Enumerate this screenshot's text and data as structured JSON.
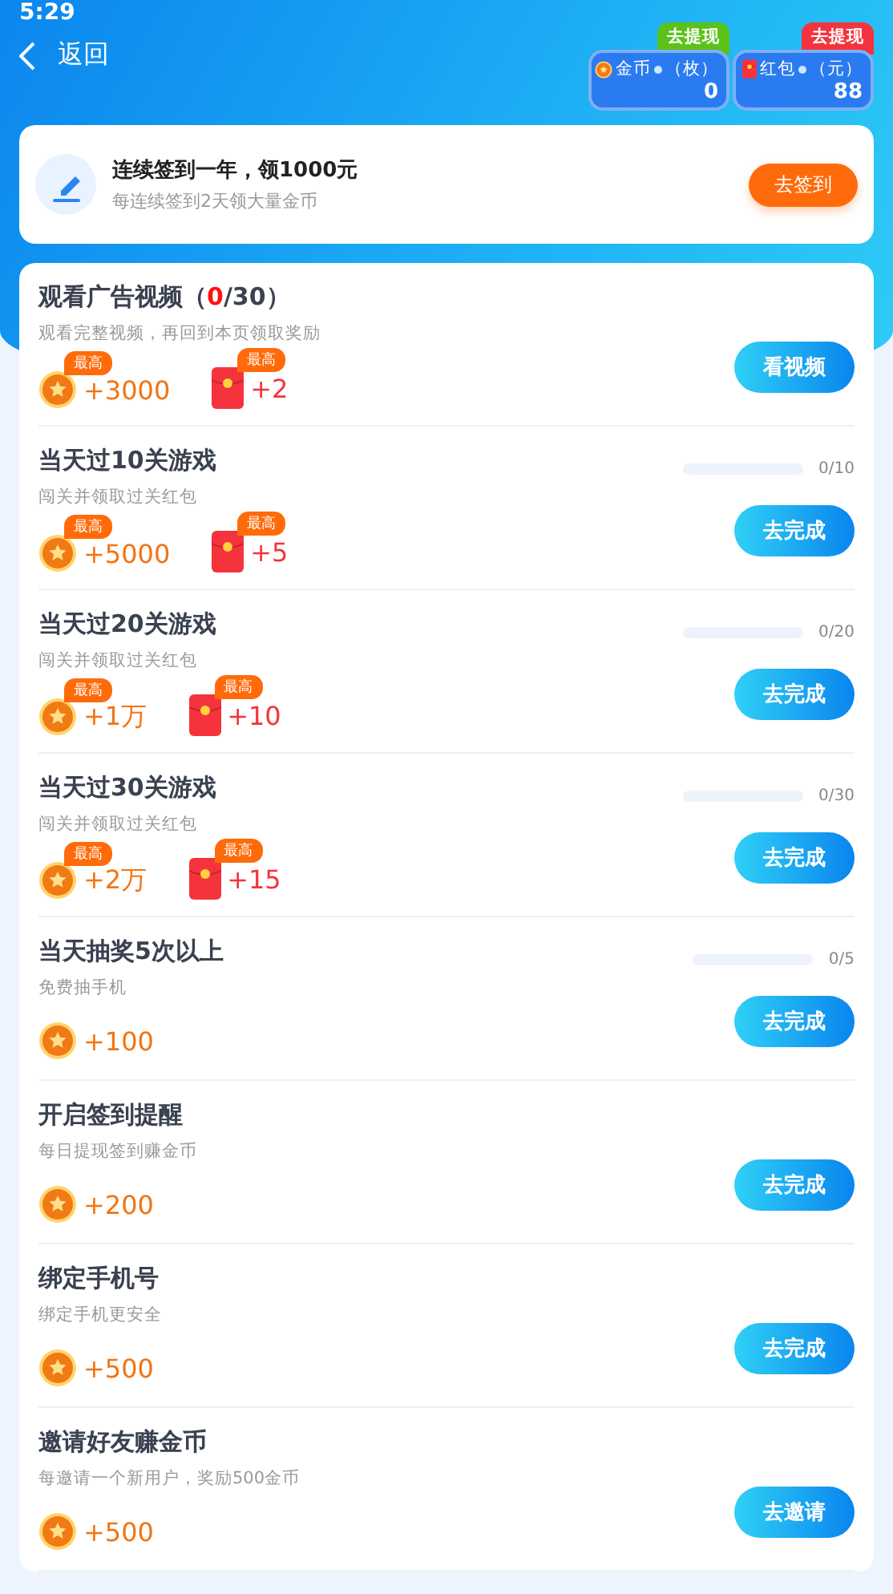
{
  "status_bar": {
    "time": "5:29"
  },
  "header": {
    "back": "返回"
  },
  "balances": [
    {
      "kind": "coin",
      "label": "金币",
      "unit": "（枚）",
      "value": "0",
      "badge": "去提现",
      "color": "#5cc21a"
    },
    {
      "kind": "packet",
      "label": "红包",
      "unit": "（元）",
      "value": "88",
      "badge": "去提现",
      "color": "#f4333c"
    }
  ],
  "sign_in": {
    "title": "连续签到一年，领1000元",
    "subtitle": "每连续签到2天领大量金币",
    "button": "去签到"
  },
  "tasks": [
    {
      "title": "观看广告视频（",
      "count": "0",
      "title_end": "/30）",
      "desc": "观看完整视频，再回到本页领取奖励",
      "rewards": [
        {
          "kind": "coin",
          "badge": "最高",
          "amount": "+3000"
        },
        {
          "kind": "packet",
          "badge": "最高",
          "amount": "+2"
        }
      ],
      "button": "看视频"
    },
    {
      "title": "当天过10关游戏",
      "desc": "闯关并领取过关红包",
      "progress": {
        "level": 0,
        "reading": "0/10"
      },
      "rewards": [
        {
          "kind": "coin",
          "badge": "最高",
          "amount": "+5000"
        },
        {
          "kind": "packet",
          "badge": "最高",
          "amount": "+5"
        }
      ],
      "button": "去完成"
    },
    {
      "title": "当天过20关游戏",
      "desc": "闯关并领取过关红包",
      "progress": {
        "level": 0,
        "reading": "0/20"
      },
      "rewards": [
        {
          "kind": "coin",
          "badge": "最高",
          "amount": "+1万"
        },
        {
          "kind": "packet",
          "badge": "最高",
          "amount": "+10"
        }
      ],
      "button": "去完成"
    },
    {
      "title": "当天过30关游戏",
      "desc": "闯关并领取过关红包",
      "progress": {
        "level": 0,
        "reading": "0/30"
      },
      "rewards": [
        {
          "kind": "coin",
          "badge": "最高",
          "amount": "+2万"
        },
        {
          "kind": "packet",
          "badge": "最高",
          "amount": "+15"
        }
      ],
      "button": "去完成"
    },
    {
      "title": "当天抽奖5次以上",
      "desc": "免费抽手机",
      "progress": {
        "level": 0,
        "reading": "0/5"
      },
      "rewards": [
        {
          "kind": "coin",
          "amount": "+100"
        }
      ],
      "button": "去完成"
    },
    {
      "title": "开启签到提醒",
      "desc": "每日提现签到赚金币",
      "rewards": [
        {
          "kind": "coin",
          "amount": "+200"
        }
      ],
      "button": "去完成"
    },
    {
      "title": "绑定手机号",
      "desc": "绑定手机更安全",
      "rewards": [
        {
          "kind": "coin",
          "amount": "+500"
        }
      ],
      "button": "去完成"
    },
    {
      "title": "邀请好友赚金币",
      "desc": "每邀请一个新用户，奖励500金币",
      "rewards": [
        {
          "kind": "coin",
          "amount": "+500"
        }
      ],
      "button": "去邀请"
    }
  ]
}
